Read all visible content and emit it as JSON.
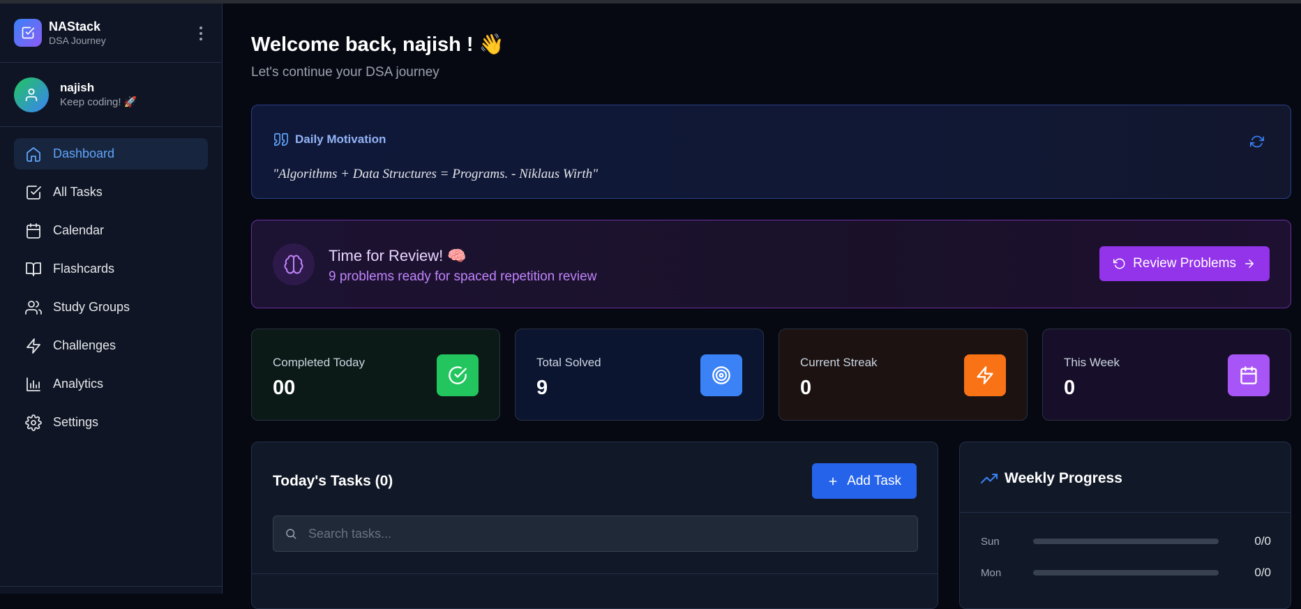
{
  "brand": {
    "name": "NAStack",
    "subtitle": "DSA Journey"
  },
  "user": {
    "name": "najish",
    "status": "Keep coding! 🚀"
  },
  "nav": [
    {
      "label": "Dashboard",
      "icon": "home-icon",
      "active": true
    },
    {
      "label": "All Tasks",
      "icon": "check-square-icon"
    },
    {
      "label": "Calendar",
      "icon": "calendar-icon"
    },
    {
      "label": "Flashcards",
      "icon": "book-open-icon"
    },
    {
      "label": "Study Groups",
      "icon": "users-icon"
    },
    {
      "label": "Challenges",
      "icon": "zap-icon"
    },
    {
      "label": "Analytics",
      "icon": "bar-chart-icon"
    },
    {
      "label": "Settings",
      "icon": "gear-icon"
    }
  ],
  "header": {
    "welcome": "Welcome back, najish ! 👋",
    "subtitle": "Let's continue your DSA journey"
  },
  "motivation": {
    "title": "Daily Motivation",
    "quote": "\"Algorithms + Data Structures = Programs. - Niklaus Wirth\""
  },
  "review": {
    "title": "Time for Review! 🧠",
    "subtitle": "9 problems ready for spaced repetition review",
    "button_label": "Review Problems"
  },
  "stats": [
    {
      "label": "Completed Today",
      "value": "00",
      "icon": "check-circle-icon",
      "color": "#22c55e",
      "bg": "#0b1a16"
    },
    {
      "label": "Total Solved",
      "value": "9",
      "icon": "target-icon",
      "color": "#3b82f6",
      "bg": "#0c1530"
    },
    {
      "label": "Current Streak",
      "value": "0",
      "icon": "zap-icon",
      "color": "#f97316",
      "bg": "#1c1212"
    },
    {
      "label": "This Week",
      "value": "0",
      "icon": "calendar-icon",
      "color": "#a855f7",
      "bg": "#170f29"
    }
  ],
  "tasks": {
    "title": "Today's Tasks (0)",
    "add_label": "Add Task",
    "search_placeholder": "Search tasks..."
  },
  "weekly": {
    "title": "Weekly Progress",
    "rows": [
      {
        "day": "Sun",
        "count": "0/0",
        "progress": 0
      },
      {
        "day": "Mon",
        "count": "0/0",
        "progress": 0
      }
    ]
  },
  "colors": {
    "accent": "#3b82f6",
    "purple": "#9333ea",
    "background": "#060912"
  }
}
